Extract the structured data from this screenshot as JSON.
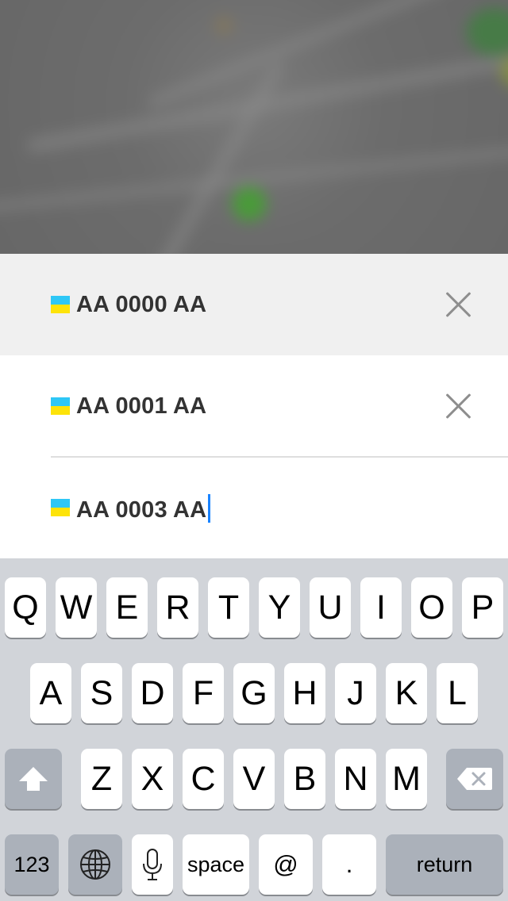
{
  "plates": [
    {
      "text": "AA 0000 AA",
      "selected": true,
      "deletable": true
    },
    {
      "text": "AA 0001 AA",
      "selected": false,
      "deletable": true
    },
    {
      "text": "AA 0003 AA",
      "selected": false,
      "deletable": false,
      "editing": true
    }
  ],
  "flag_colors": {
    "top": "#2ec7f6",
    "bottom": "#fde309"
  },
  "keyboard": {
    "row1": [
      "Q",
      "W",
      "E",
      "R",
      "T",
      "Y",
      "U",
      "I",
      "O",
      "P"
    ],
    "row2": [
      "A",
      "S",
      "D",
      "F",
      "G",
      "H",
      "J",
      "K",
      "L"
    ],
    "row3": [
      "Z",
      "X",
      "C",
      "V",
      "B",
      "N",
      "M"
    ],
    "numbers_label": "123",
    "space_label": "space",
    "at_label": "@",
    "period_label": ".",
    "return_label": "return",
    "icons": [
      "shift-icon",
      "backspace-icon",
      "globe-icon",
      "microphone-icon"
    ]
  }
}
